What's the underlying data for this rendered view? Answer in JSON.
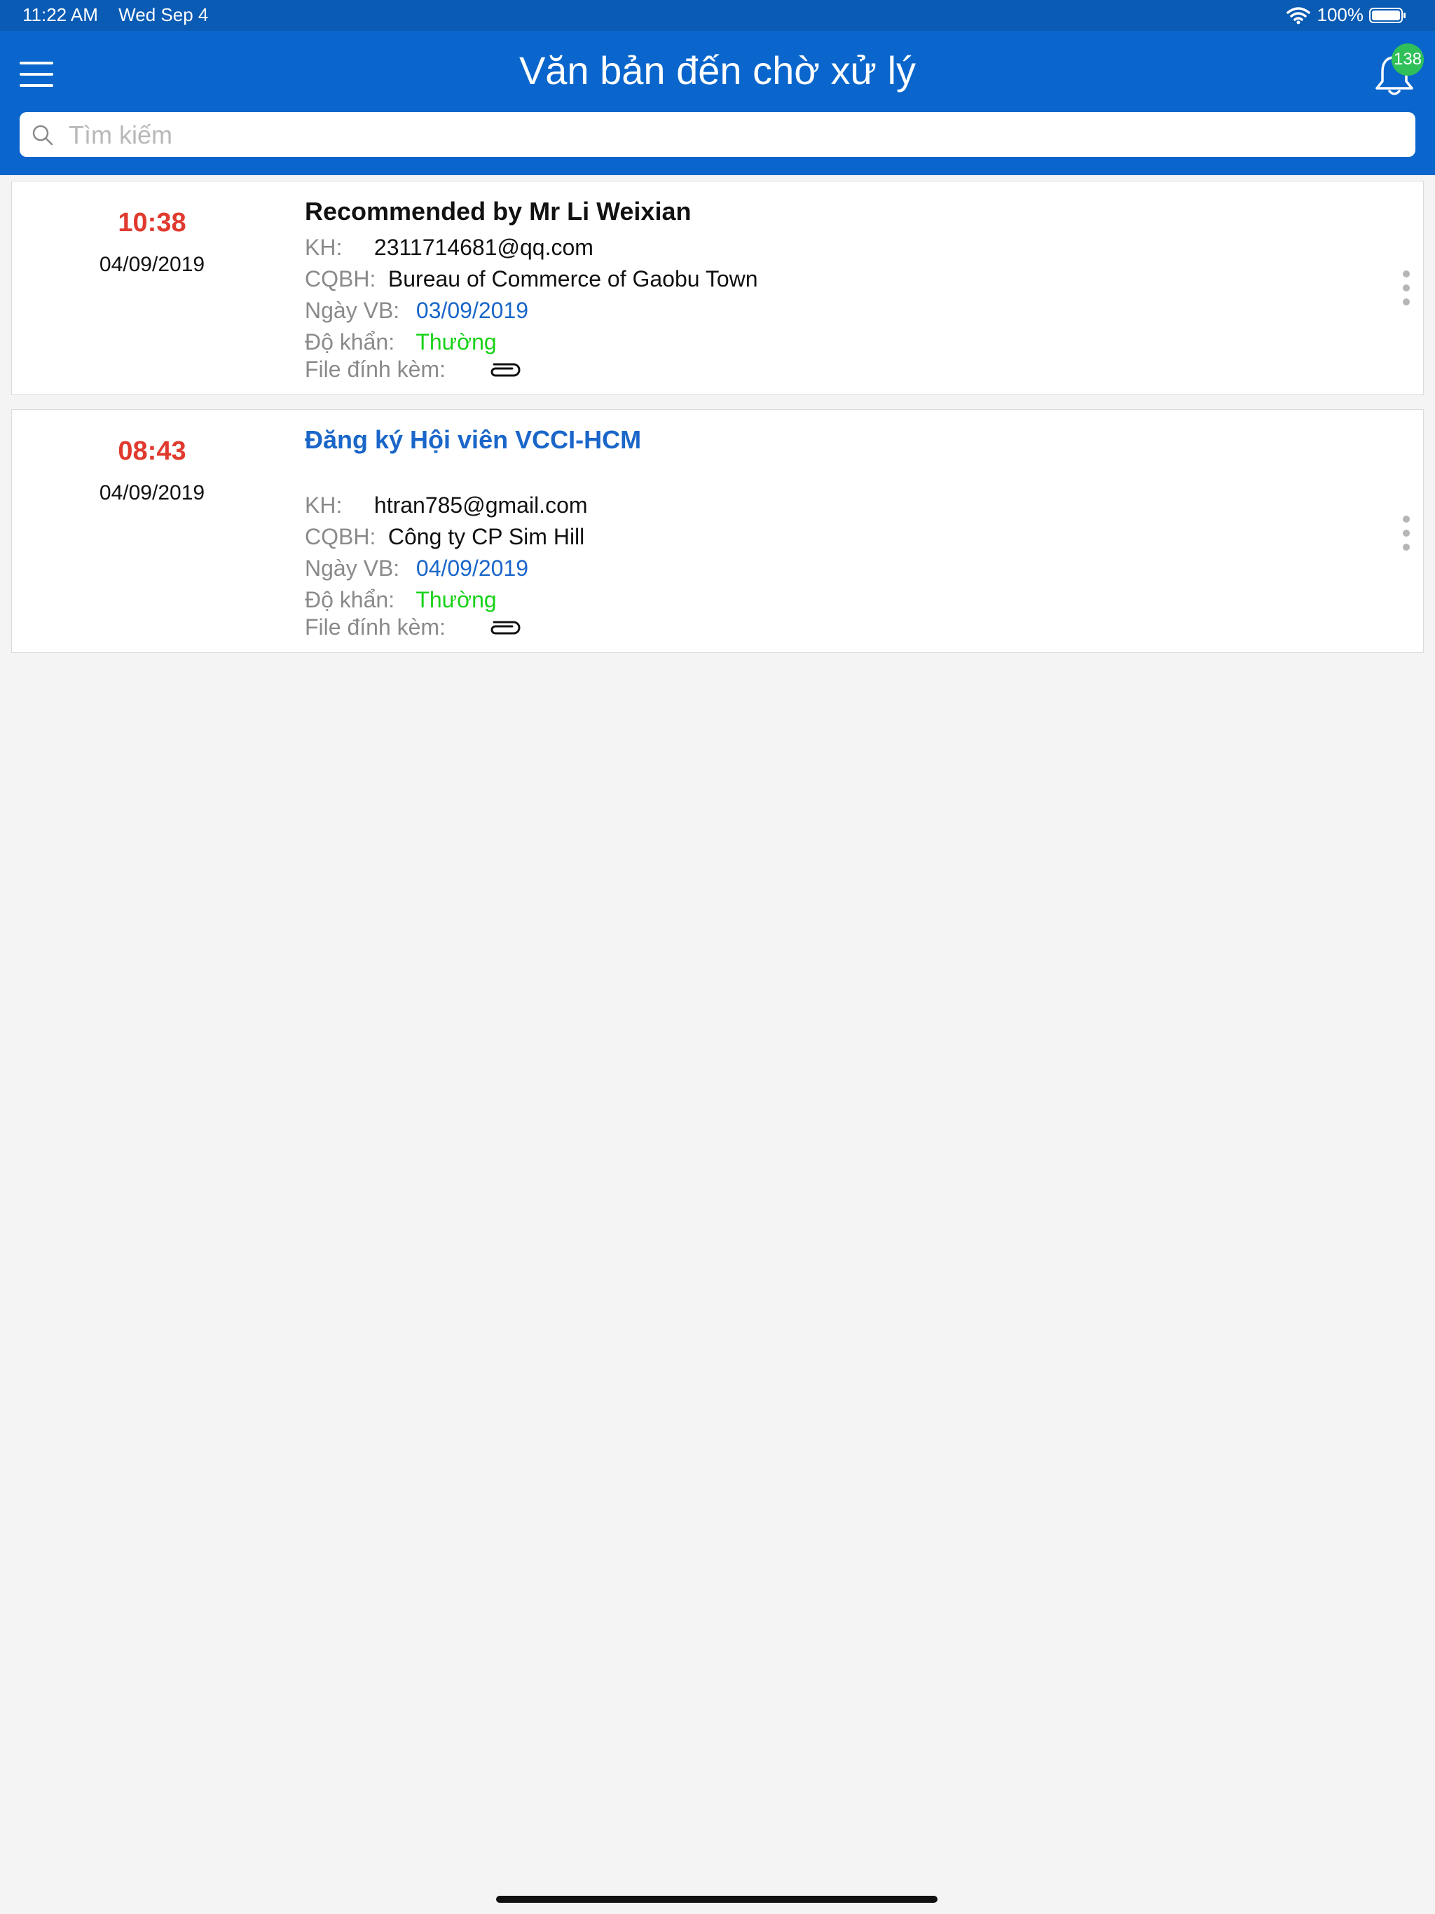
{
  "status_bar": {
    "time": "11:22 AM",
    "date": "Wed Sep 4",
    "battery": "100%",
    "wifi_icon": "wifi-icon",
    "battery_icon": "battery-icon"
  },
  "header": {
    "title": "Văn bản đến chờ xử lý",
    "menu_icon": "hamburger-menu-icon",
    "bell_icon": "bell-icon",
    "badge_count": "138",
    "badge_color": "#2fc05a",
    "bar_color": "#0a66cc"
  },
  "search": {
    "placeholder": "Tìm kiếm",
    "value": ""
  },
  "documents": [
    {
      "time": "10:38",
      "date": "04/09/2019",
      "subject": "Recommended by Mr Li Weixian",
      "kh_label": "KH:",
      "kh_value": "2311714681@qq.com",
      "cqbh_label": "CQBH:",
      "cqbh_value": "Bureau of Commerce of Gaobu Town",
      "ngay_label": "Ngày VB:",
      "ngay_value": "03/09/2019",
      "dokhan_label": "Độ khẩn:",
      "dokhan_value": "Thường",
      "file_label": "File đính kèm:"
    },
    {
      "time": "08:43",
      "date": "04/09/2019",
      "subject": "Đăng ký Hội viên VCCI-HCM",
      "kh_label": "KH:",
      "kh_value": "htran785@gmail.com",
      "cqbh_label": "CQBH:",
      "cqbh_value": "Công ty CP Sim Hill",
      "ngay_label": "Ngày VB:",
      "ngay_value": "04/09/2019",
      "dokhan_label": "Độ khẩn:",
      "dokhan_value": "Thường",
      "file_label": "File đính kèm:"
    }
  ],
  "colors": {
    "time_red": "#e03a2e",
    "date_blue": "#1a66c9",
    "urgency_green": "#19d219"
  }
}
